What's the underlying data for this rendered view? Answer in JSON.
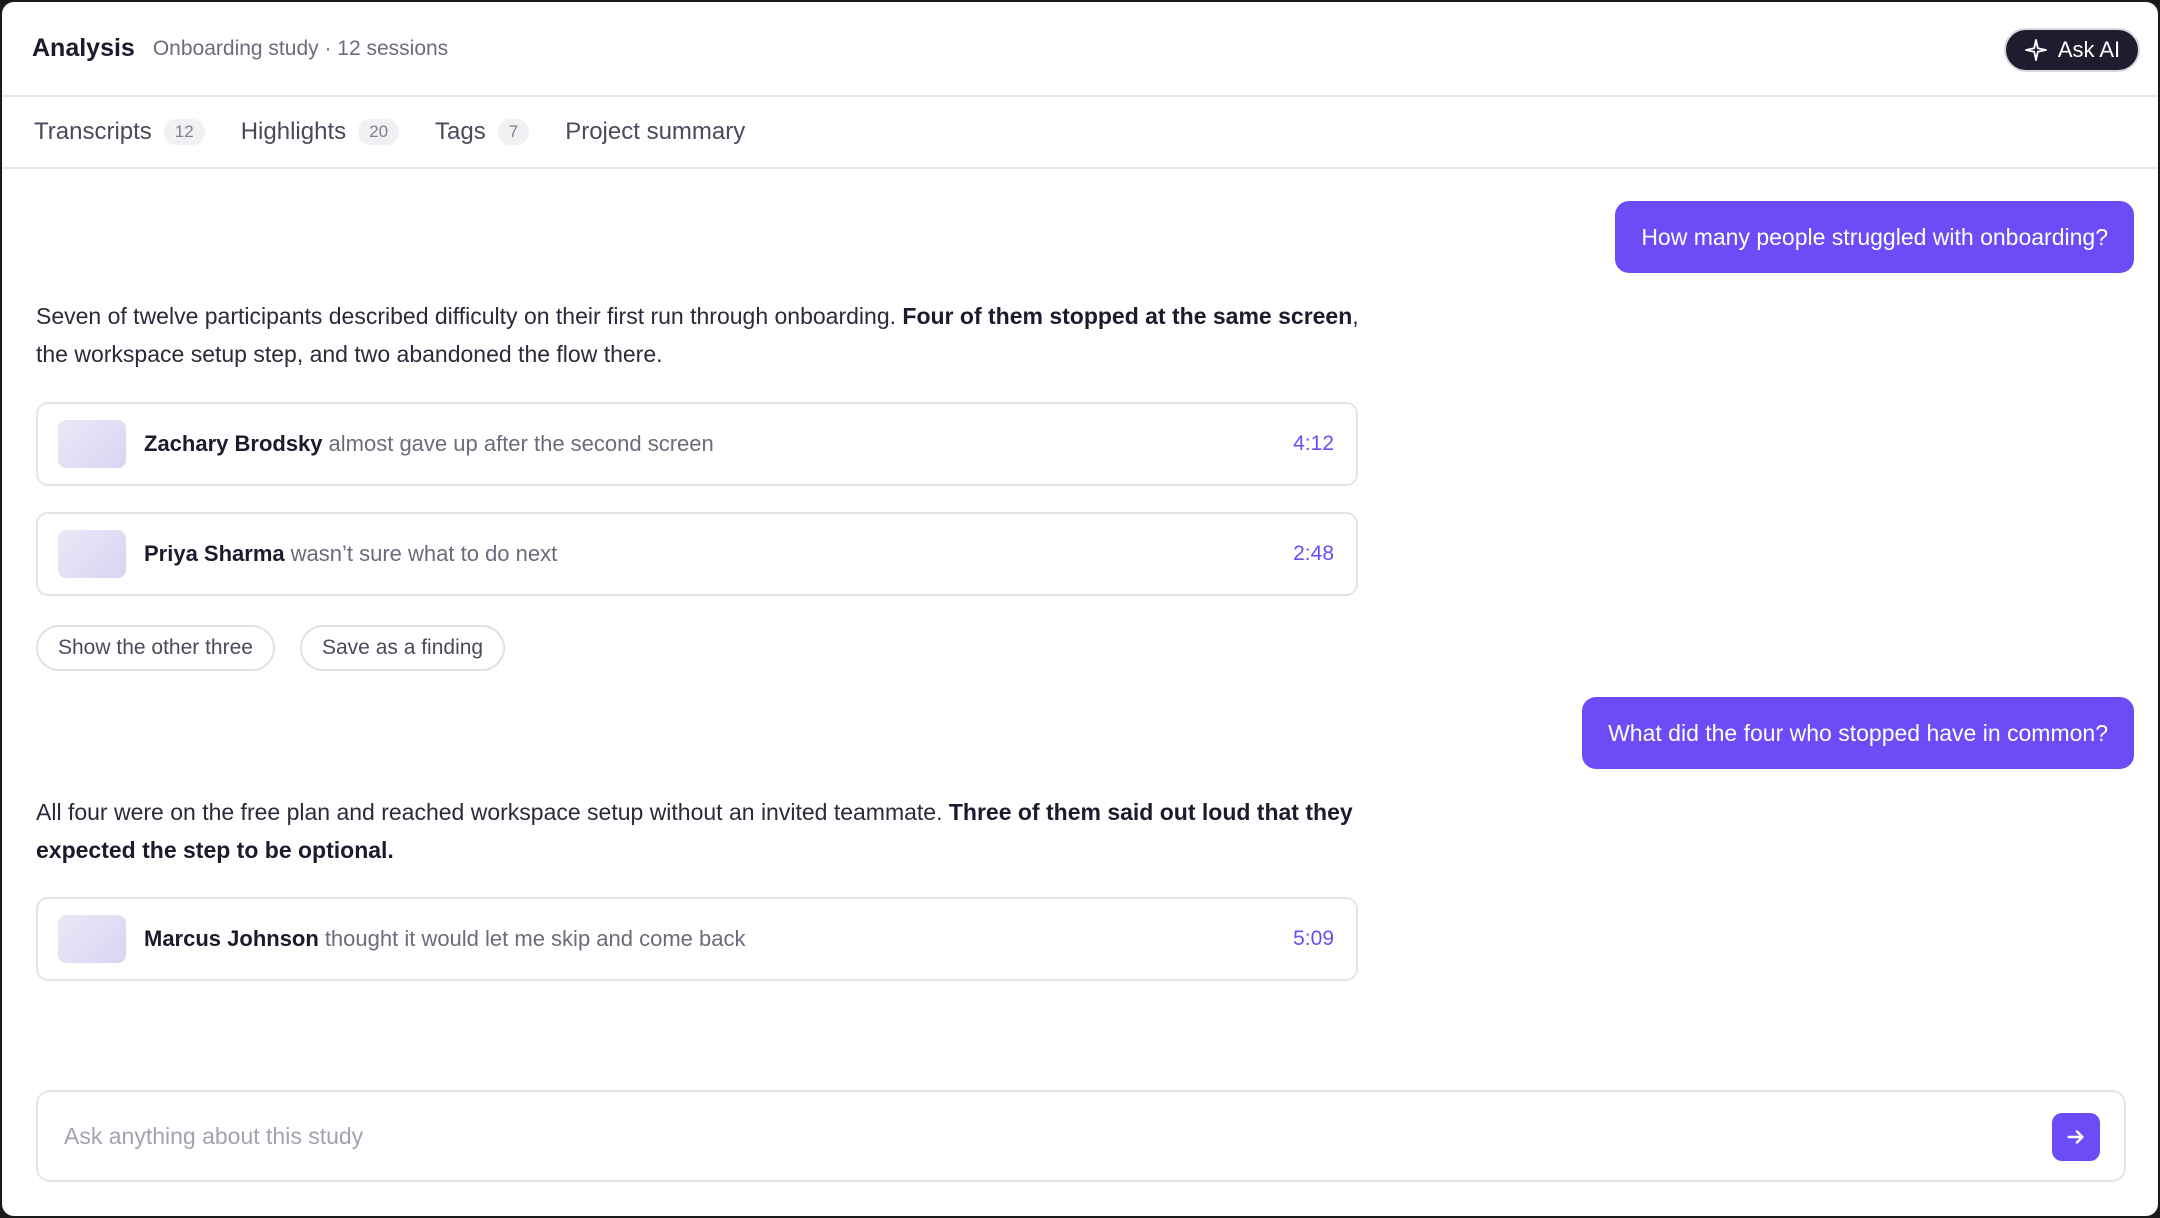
{
  "header": {
    "title": "Analysis",
    "subtitle": "Onboarding study · 12 sessions",
    "ask_ai_label": "Ask AI"
  },
  "tabs": [
    {
      "label": "Transcripts",
      "count": "12"
    },
    {
      "label": "Highlights",
      "count": "20"
    },
    {
      "label": "Tags",
      "count": "7"
    },
    {
      "label": "Project summary"
    }
  ],
  "conversation": {
    "q1": "How many people struggled with onboarding?",
    "a1": {
      "text_before": "Seven of twelve participants described difficulty on their first run through onboarding. ",
      "text_bold": "Four of them stopped at the same screen",
      "text_after": ", the workspace setup step, and two abandoned the flow there."
    },
    "clips1": [
      {
        "name": "Zachary Brodsky",
        "quote": "almost gave up after the second screen",
        "time": "4:12"
      },
      {
        "name": "Priya Sharma",
        "quote": "wasn’t sure what to do next",
        "time": "2:48"
      }
    ],
    "actions": [
      "Show the other three",
      "Save as a finding"
    ],
    "q2": "What did the four who stopped have in common?",
    "a2": {
      "text_before": "All four were on the free plan and reached workspace setup without an invited teammate. ",
      "text_bold": "Three of them said out loud that they expected the step to be optional."
    },
    "clips2": [
      {
        "name": "Marcus Johnson",
        "quote": "thought it would let me skip and come back",
        "time": "5:09"
      }
    ]
  },
  "composer": {
    "placeholder": "Ask anything about this study"
  },
  "colors": {
    "accent": "#6b4cf6",
    "dark_button": "#1e1d2f"
  }
}
